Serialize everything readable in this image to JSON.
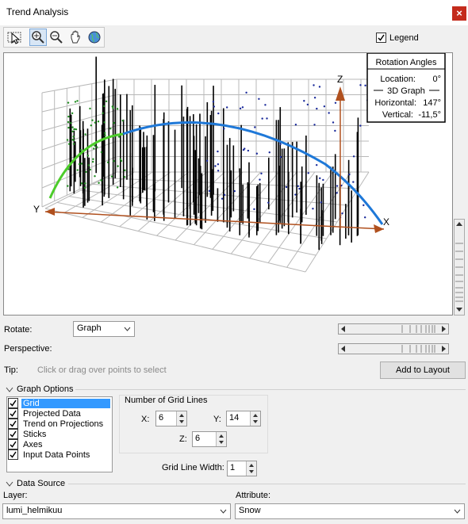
{
  "window": {
    "title": "Trend Analysis",
    "close_glyph": "×"
  },
  "toolbar": {
    "tools": [
      {
        "name": "select-tool-icon"
      },
      {
        "name": "zoom-in-icon"
      },
      {
        "name": "zoom-out-icon"
      },
      {
        "name": "pan-hand-icon"
      },
      {
        "name": "full-extent-globe-icon"
      }
    ],
    "legend_label": "Legend",
    "legend_checked": true
  },
  "graph": {
    "x_axis": "X",
    "y_axis": "Y",
    "z_axis": "Z",
    "rotation_box": {
      "title": "Rotation Angles",
      "location_label": "Location:",
      "location_value": "0°",
      "section_label": "3D Graph",
      "horizontal_label": "Horizontal:",
      "horizontal_value": "147°",
      "vertical_label": "Vertical:",
      "vertical_value": "-11,5°"
    },
    "colors": {
      "grid": "#b0b0b0",
      "axis": "#b0501e",
      "trend_x": "#1e78d8",
      "trend_y": "#50c828",
      "sticks": "#000000",
      "points_y": "#1e8c1e",
      "points_x": "#1a2a9a"
    }
  },
  "controls": {
    "rotate_label": "Rotate:",
    "rotate_value": "Graph",
    "perspective_label": "Perspective:",
    "tip_label": "Tip:",
    "tip_text": "Click or drag over points to select",
    "add_to_layout": "Add to Layout"
  },
  "graph_options": {
    "header": "Graph Options",
    "items": [
      {
        "label": "Grid",
        "checked": true,
        "selected": true
      },
      {
        "label": "Projected Data",
        "checked": true,
        "selected": false
      },
      {
        "label": "Trend on Projections",
        "checked": true,
        "selected": false
      },
      {
        "label": "Sticks",
        "checked": true,
        "selected": false
      },
      {
        "label": "Axes",
        "checked": true,
        "selected": false
      },
      {
        "label": "Input Data Points",
        "checked": true,
        "selected": false
      }
    ],
    "grid_lines_title": "Number of Grid Lines",
    "x_label": "X:",
    "x_value": "6",
    "y_label": "Y:",
    "y_value": "14",
    "z_label": "Z:",
    "z_value": "6",
    "grid_width_label": "Grid Line Width:",
    "grid_width_value": "1"
  },
  "data_source": {
    "header": "Data Source",
    "layer_label": "Layer:",
    "layer_value": "lumi_helmikuu",
    "attribute_label": "Attribute:",
    "attribute_value": "Snow"
  }
}
